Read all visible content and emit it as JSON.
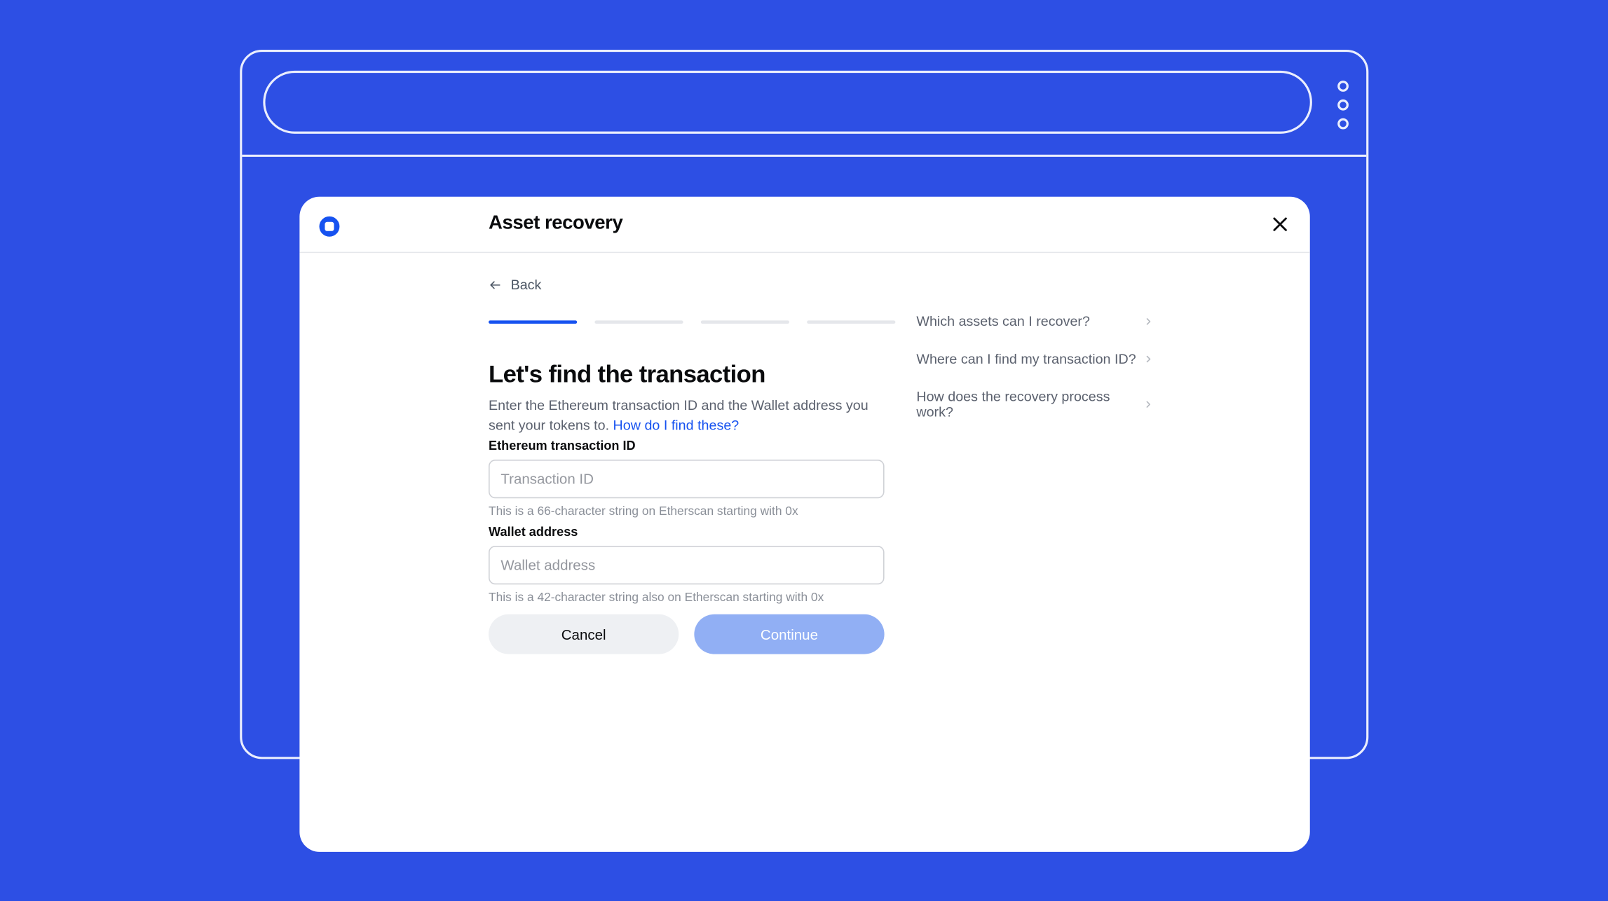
{
  "header": {
    "title": "Asset recovery"
  },
  "back": {
    "label": "Back"
  },
  "colors": {
    "background": "#2d4fe4",
    "accent": "#1652f0"
  },
  "main": {
    "heading": "Let's find the transaction",
    "description_part1": "Enter the Ethereum transaction ID and the Wallet address you sent your tokens to. ",
    "description_link": "How do I find these?"
  },
  "fields": {
    "txid": {
      "label": "Ethereum transaction ID",
      "placeholder": "Transaction ID",
      "helper": "This is a 66-character string on Etherscan starting with 0x"
    },
    "wallet": {
      "label": "Wallet address",
      "placeholder": "Wallet address",
      "helper": "This is a 42-character string also on Etherscan starting with 0x"
    }
  },
  "buttons": {
    "cancel": "Cancel",
    "continue": "Continue"
  },
  "faq": {
    "items": [
      {
        "label": "Which assets can I recover?"
      },
      {
        "label": "Where can I find my transaction ID?"
      },
      {
        "label": "How does the recovery process work?"
      }
    ]
  }
}
